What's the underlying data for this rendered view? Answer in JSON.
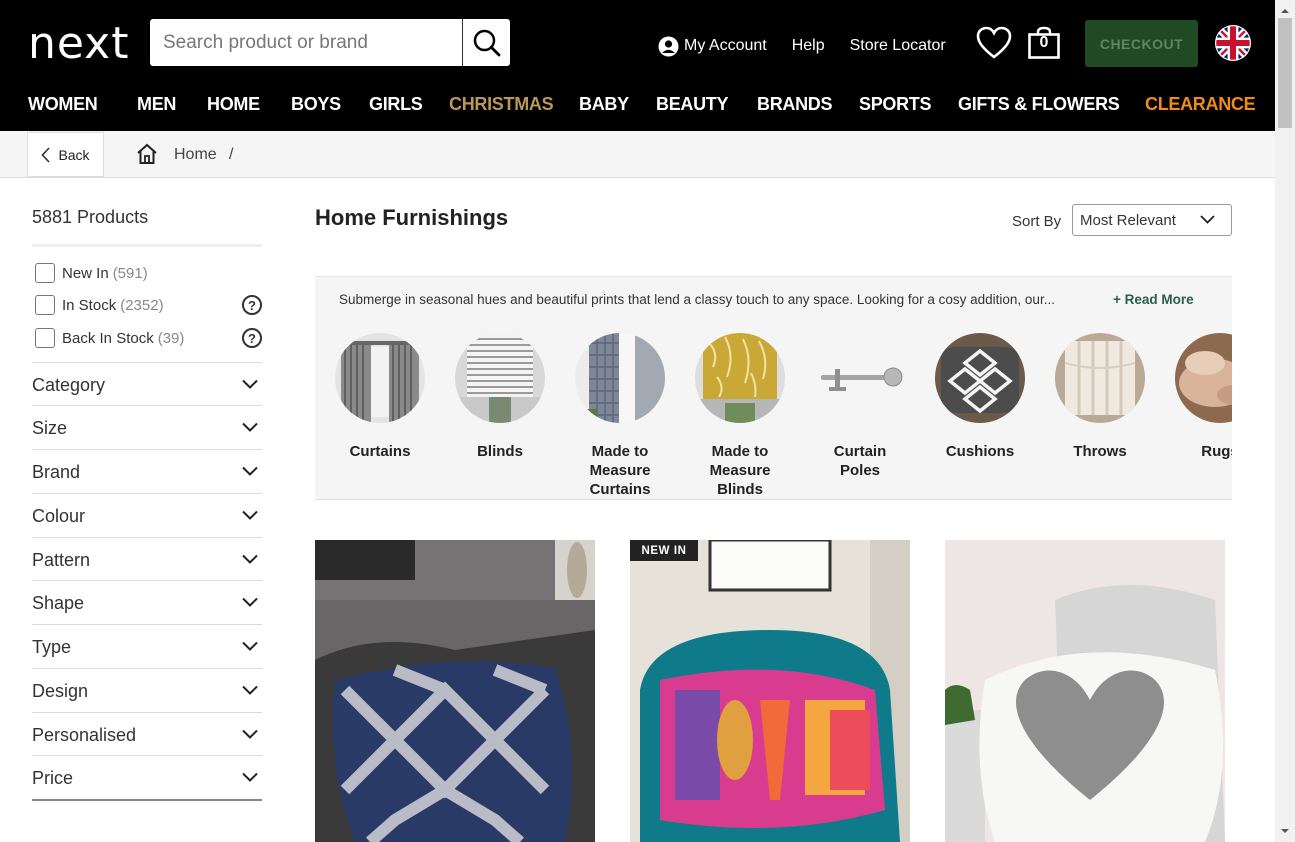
{
  "header": {
    "logo": "next",
    "search_placeholder": "Search product or brand",
    "account_label": "My Account",
    "help_label": "Help",
    "store_label": "Store Locator",
    "bag_count": "0",
    "checkout_label": "CHECKOUT"
  },
  "nav": [
    "WOMEN",
    "MEN",
    "HOME",
    "BOYS",
    "GIRLS",
    "CHRISTMAS",
    "BABY",
    "BEAUTY",
    "BRANDS",
    "SPORTS",
    "GIFTS & FLOWERS",
    "CLEARANCE"
  ],
  "breadcrumb": {
    "back": "Back",
    "home": "Home",
    "sep": "/"
  },
  "sidebar": {
    "count": "5881 Products",
    "checks": [
      {
        "label": "New In",
        "num": "(591)"
      },
      {
        "label": "In Stock",
        "num": "(2352)"
      },
      {
        "label": "Back In Stock",
        "num": "(39)"
      }
    ],
    "help": "?",
    "facets": [
      "Category",
      "Size",
      "Brand",
      "Colour",
      "Pattern",
      "Shape",
      "Type",
      "Design",
      "Personalised",
      "Price"
    ]
  },
  "main": {
    "title": "Home Furnishings",
    "sort_label": "Sort By",
    "sort_value": "Most Relevant",
    "description": "Submerge in seasonal hues and beautiful prints that lend a classy touch to any space. Looking for a cosy addition, our...",
    "read_more": "+ Read More",
    "categories": [
      {
        "label1": "Curtains",
        "label2": "",
        "label3": ""
      },
      {
        "label1": "Blinds",
        "label2": "",
        "label3": ""
      },
      {
        "label1": "Made to",
        "label2": "Measure",
        "label3": "Curtains"
      },
      {
        "label1": "Made to",
        "label2": "Measure",
        "label3": "Blinds"
      },
      {
        "label1": "Curtain",
        "label2": "Poles",
        "label3": ""
      },
      {
        "label1": "Cushions",
        "label2": "",
        "label3": ""
      },
      {
        "label1": "Throws",
        "label2": "",
        "label3": ""
      },
      {
        "label1": "Rugs",
        "label2": "",
        "label3": ""
      }
    ],
    "badge": "NEW IN"
  },
  "colors": {
    "header_bg": "#000000",
    "checkout_bg": "#1f4a22",
    "christmas": "#b8975a",
    "clearance": "#ef8a1c"
  }
}
